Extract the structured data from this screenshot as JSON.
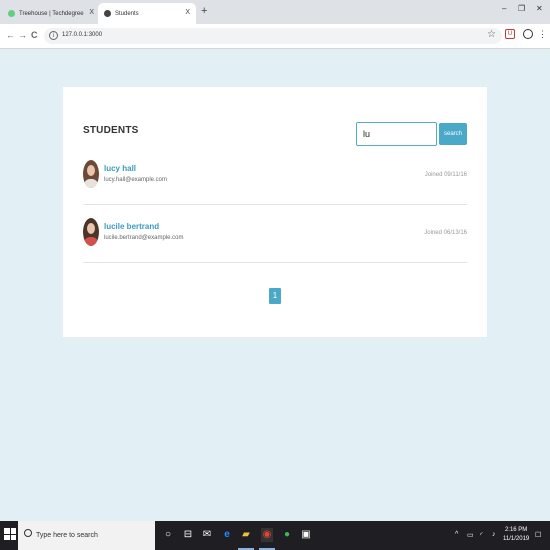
{
  "browser": {
    "tabs": [
      {
        "label": "Treehouse | Techdegree",
        "close": "X"
      },
      {
        "label": "Students",
        "close": "X"
      }
    ],
    "new_tab": "+",
    "window_controls": {
      "minimize": "–",
      "restore": "❐",
      "close": "✕"
    },
    "nav": {
      "back": "←",
      "forward": "→",
      "reload": "C"
    },
    "url": "127.0.0.1:3000",
    "info_glyph": "i",
    "star": "☆",
    "ext_badge": "U",
    "menu": "⋮"
  },
  "page": {
    "title": "STUDENTS",
    "search": {
      "value": "lu",
      "button_label": "search"
    },
    "students": [
      {
        "name": "lucy hall",
        "email": "lucy.hall@example.com",
        "joined": "Joined 09/11/16"
      },
      {
        "name": "lucile bertrand",
        "email": "lucile.bertrand@example.com",
        "joined": "Joined 06/13/16"
      }
    ],
    "pagination": [
      "1"
    ]
  },
  "taskbar": {
    "search_placeholder": "Type here to search",
    "tray_caret": "^",
    "clock_time": "2:16 PM",
    "clock_date": "11/1/2019",
    "notification": "☐"
  },
  "colors": {
    "accent": "#4aa8c8",
    "page_bg": "#e2eff5",
    "link": "#3b9bc1"
  }
}
